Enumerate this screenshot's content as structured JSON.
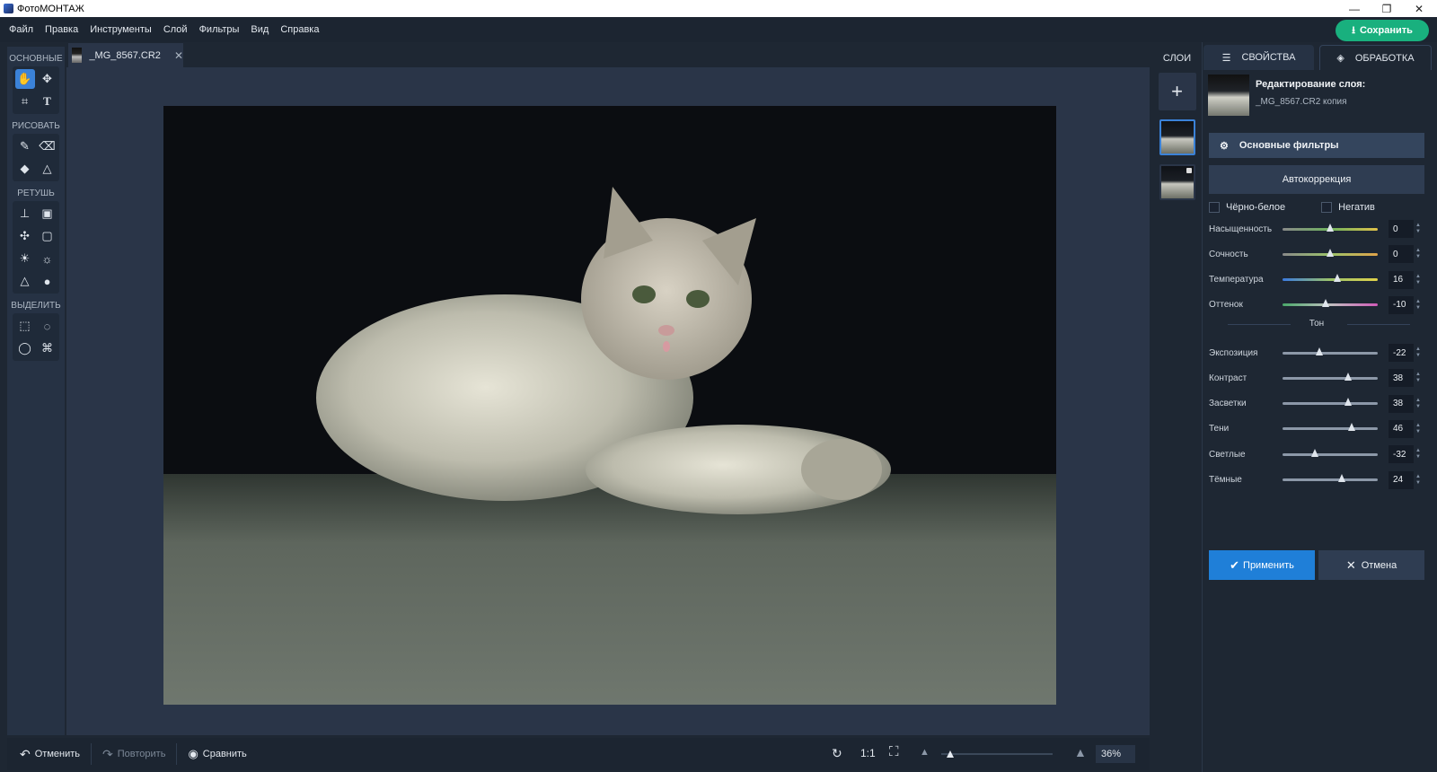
{
  "window": {
    "title": "ФотоМОНТАЖ"
  },
  "menu": [
    "Файл",
    "Правка",
    "Инструменты",
    "Слой",
    "Фильтры",
    "Вид",
    "Справка"
  ],
  "save_button": "Сохранить",
  "toolbar": {
    "sections": [
      "ОСНОВНЫЕ",
      "РИСОВАТЬ",
      "РЕТУШЬ",
      "ВЫДЕЛИТЬ"
    ],
    "tools": {
      "basic": [
        "hand-icon",
        "move-icon",
        "crop-icon",
        "text-icon"
      ],
      "draw": [
        "brush-icon",
        "eraser-icon",
        "fill-icon",
        "shapes-icon"
      ],
      "retouch": [
        "stamp-icon",
        "patch-icon",
        "healing-icon",
        "frame-icon",
        "lighten-icon",
        "darken-icon",
        "sharpen-icon",
        "blur-icon"
      ],
      "select": [
        "rect-select-icon",
        "ellipse-select-icon",
        "lasso-icon",
        "polygon-lasso-icon"
      ]
    }
  },
  "document_tab": {
    "name": "_MG_8567.CR2"
  },
  "statusbar": {
    "undo": "Отменить",
    "redo": "Повторить",
    "compare": "Сравнить",
    "one_to_one": "1:1",
    "zoom": "36%"
  },
  "layers_panel": {
    "title": "СЛОИ"
  },
  "right_panel": {
    "tabs": [
      "СВОЙСТВА",
      "ОБРАБОТКА"
    ],
    "layer_title": "Редактирование слоя:",
    "layer_name": "_MG_8567.CR2 копия",
    "filter_header": "Основные фильтры",
    "autocorrection": "Автокоррекция",
    "checkboxes": [
      "Чёрно-белое",
      "Негатив"
    ],
    "color_sliders": [
      {
        "label": "Насыщенность",
        "value": "0",
        "pos": 0.5
      },
      {
        "label": "Сочность",
        "value": "0",
        "pos": 0.5
      },
      {
        "label": "Температура",
        "value": "16",
        "pos": 0.58
      },
      {
        "label": "Оттенок",
        "value": "-10",
        "pos": 0.45
      }
    ],
    "tone_label": "Тон",
    "tone_sliders": [
      {
        "label": "Экспозиция",
        "value": "-22",
        "pos": 0.39
      },
      {
        "label": "Контраст",
        "value": "38",
        "pos": 0.69
      },
      {
        "label": "Засветки",
        "value": "38",
        "pos": 0.69
      },
      {
        "label": "Тени",
        "value": "46",
        "pos": 0.73
      },
      {
        "label": "Светлые",
        "value": "-32",
        "pos": 0.34
      },
      {
        "label": "Тёмные",
        "value": "24",
        "pos": 0.62
      }
    ],
    "apply": "Применить",
    "cancel": "Отмена"
  }
}
